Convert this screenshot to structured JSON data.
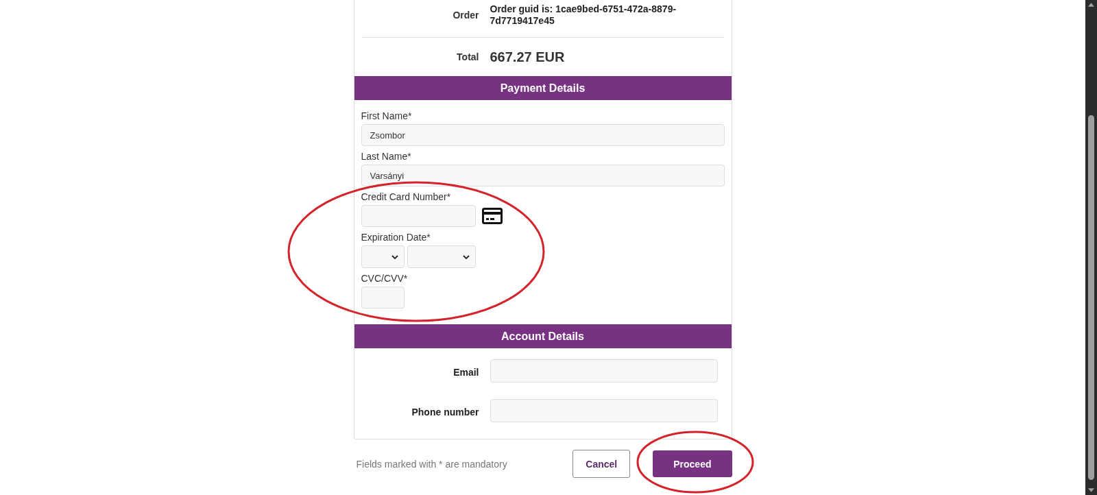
{
  "summary": [
    {
      "kind": "text",
      "label": "Order",
      "value": "Order guid is: 1cae9bed-6751-472a-8879-7d7719417e45"
    },
    {
      "kind": "amount",
      "label": "Total",
      "value": "667.27 EUR"
    }
  ],
  "payment": {
    "title": "Payment Details",
    "fields": [
      {
        "kind": "text",
        "label": "First Name*",
        "value": "Zsombor"
      },
      {
        "kind": "text",
        "label": "Last Name*",
        "value": "Varsányi"
      }
    ],
    "card": {
      "highlighted": true,
      "fields": [
        {
          "kind": "card_number",
          "label": "Credit Card Number*"
        },
        {
          "kind": "expiry",
          "label": "Expiration Date*"
        },
        {
          "kind": "cvc",
          "label": "CVC/CVV*"
        }
      ]
    }
  },
  "account": {
    "title": "Account Details",
    "fields": [
      {
        "label": "Email"
      },
      {
        "label": "Phone number"
      }
    ]
  },
  "footer": {
    "note": "Fields marked with * are mandatory",
    "buttons": [
      {
        "kind": "secondary",
        "label": "Cancel",
        "highlighted": false
      },
      {
        "kind": "primary",
        "label": "Proceed",
        "highlighted": true
      }
    ]
  }
}
